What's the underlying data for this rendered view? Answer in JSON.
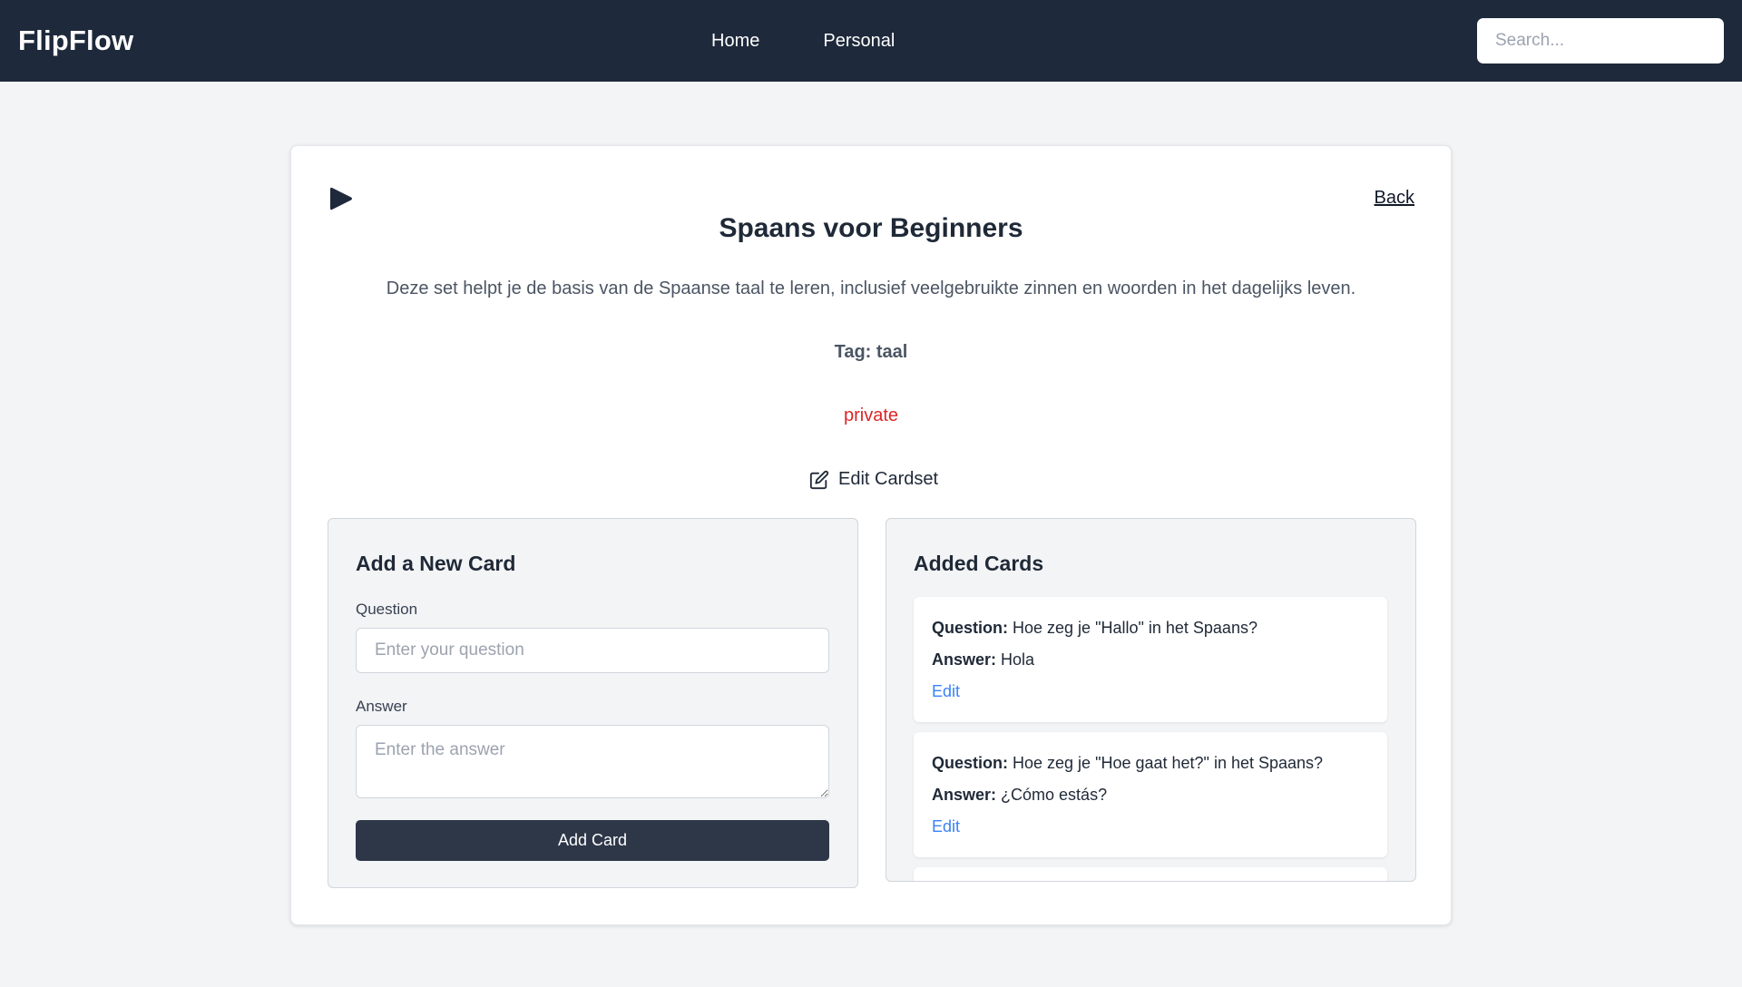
{
  "nav": {
    "brand": "FlipFlow",
    "links": [
      "Home",
      "Personal"
    ],
    "search_placeholder": "Search..."
  },
  "cardset": {
    "title": "Spaans voor Beginners",
    "description": "Deze set helpt je de basis van de Spaanse taal te leren, inclusief veelgebruikte zinnen en woorden in het dagelijks leven.",
    "tag": "Tag: taal",
    "visibility": "private",
    "edit_label": "Edit Cardset",
    "back_label": "Back",
    "play_icon": "play-icon",
    "colors": {
      "visibility": "#dc2626",
      "edit_link": "#3b82f6",
      "navbar": "#1e293b"
    }
  },
  "add_card": {
    "title": "Add a New Card",
    "question_label": "Question",
    "question_placeholder": "Enter your question",
    "question_value": "",
    "answer_label": "Answer",
    "answer_placeholder": "Enter the answer",
    "answer_value": "",
    "submit_label": "Add Card"
  },
  "added_cards": {
    "title": "Added Cards",
    "question_prefix": "Question:",
    "answer_prefix": "Answer:",
    "edit_label": "Edit",
    "cards": [
      {
        "question": "Hoe zeg je \"Hallo\" in het Spaans?",
        "answer": "Hola"
      },
      {
        "question": "Hoe zeg je \"Hoe gaat het?\" in het Spaans?",
        "answer": "¿Cómo estás?"
      },
      {
        "question": "",
        "answer": ""
      }
    ]
  }
}
